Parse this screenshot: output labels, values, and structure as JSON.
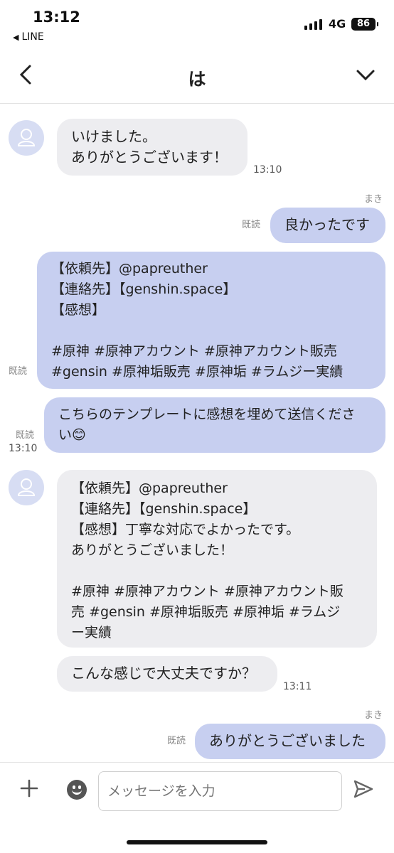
{
  "status": {
    "time": "13:12",
    "back_app": "LINE",
    "network": "4G",
    "battery": "86"
  },
  "nav": {
    "title": "は"
  },
  "messages": {
    "m1": {
      "text": "いけました。\nありがとうございます！",
      "time": "13:10"
    },
    "m2": {
      "sender": "まき",
      "read": "既読",
      "text": "良かったです"
    },
    "m3": {
      "read": "既読",
      "text": "【依頼先】@papreuther\n【連絡先】【genshin.space】\n【感想】\n\n#原神 #原神アカウント #原神アカウント販売\n#gensin #原神垢販売 #原神垢 #ラムジー実績"
    },
    "m4": {
      "read": "既読",
      "time": "13:10",
      "text": "こちらのテンプレートに感想を埋めて送信くださ\nい😊"
    },
    "m5": {
      "text": "【依頼先】@papreuther\n【連絡先】【genshin.space】\n【感想】丁寧な対応でよかったです。\nありがとうございました！\n\n#原神 #原神アカウント #原神アカウント販\n売 #gensin #原神垢販売 #原神垢 #ラムジ\nー実績"
    },
    "m6": {
      "text": "こんな感じで大丈夫ですか？",
      "time": "13:11"
    },
    "m7": {
      "sender": "まき",
      "read": "既読",
      "text": "ありがとうございました"
    }
  },
  "composer": {
    "placeholder": "メッセージを入力"
  },
  "icons": {
    "back": "chevron-left-icon",
    "menu": "chevron-down-icon",
    "add": "plus-icon",
    "emoji": "smiley-icon",
    "send": "send-icon"
  }
}
